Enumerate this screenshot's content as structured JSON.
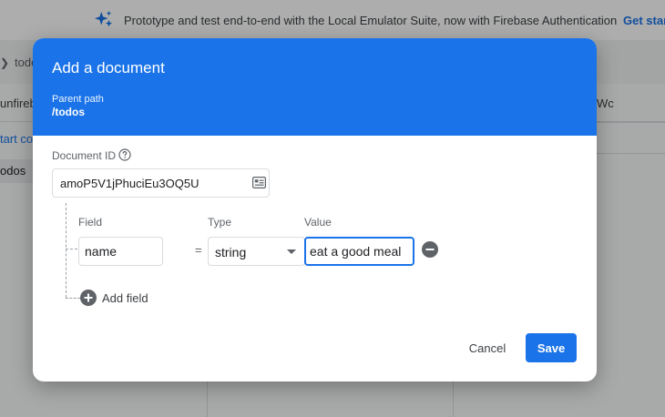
{
  "banner": {
    "icon": "sparkle-icon",
    "text": "Prototype and test end-to-end with the Local Emulator Suite, now with Firebase Authentication",
    "link_label": "Get star"
  },
  "background": {
    "breadcrumb": "todo",
    "project_path": "unfireb",
    "start_link": "tart co",
    "collection_item": "odos",
    "right_text": "Wc"
  },
  "dialog": {
    "title": "Add a document",
    "parent_path_label": "Parent path",
    "parent_path": "/todos",
    "document_id_label": "Document ID",
    "document_id_value": "amoP5V1jPhuciEu3OQ5U",
    "field_column_label": "Field",
    "type_column_label": "Type",
    "value_column_label": "Value",
    "field_row": {
      "field": "name",
      "equals": "=",
      "type": "string",
      "value": "eat a good meal"
    },
    "add_field_label": "Add field",
    "cancel_label": "Cancel",
    "save_label": "Save"
  },
  "colors": {
    "accent": "#1a73e8",
    "scrim": "rgba(0,0,0,0.32)"
  }
}
